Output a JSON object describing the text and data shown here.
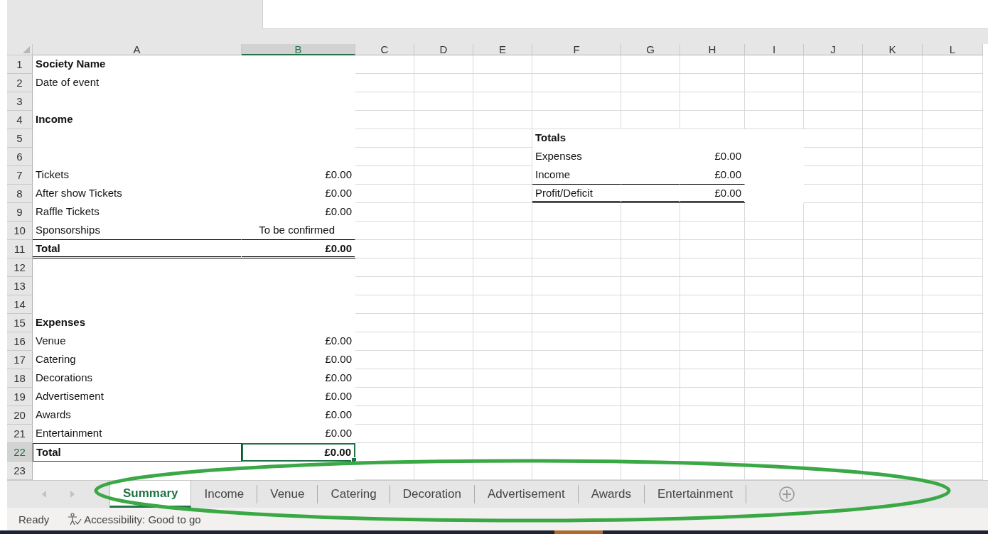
{
  "columns": [
    {
      "label": "A",
      "selected": false
    },
    {
      "label": "B",
      "selected": true
    },
    {
      "label": "C",
      "selected": false
    },
    {
      "label": "D",
      "selected": false
    },
    {
      "label": "E",
      "selected": false
    },
    {
      "label": "F",
      "selected": false
    },
    {
      "label": "G",
      "selected": false
    },
    {
      "label": "H",
      "selected": false
    },
    {
      "label": "I",
      "selected": false
    },
    {
      "label": "J",
      "selected": false
    },
    {
      "label": "K",
      "selected": false
    },
    {
      "label": "L",
      "selected": false
    }
  ],
  "rows": [
    {
      "number": "1",
      "selected": false,
      "a": {
        "text": "Society Name",
        "bold": true
      }
    },
    {
      "number": "2",
      "selected": false,
      "a": {
        "text": "Date of event"
      }
    },
    {
      "number": "3",
      "selected": false
    },
    {
      "number": "4",
      "selected": false,
      "a": {
        "text": "Income",
        "bold": true
      }
    },
    {
      "number": "5",
      "selected": false,
      "f": {
        "text": "Totals",
        "bold": true,
        "white_fill": true
      },
      "g": {
        "white_fill": true
      },
      "h": {
        "white_fill": true
      },
      "i": {
        "white_fill": true
      }
    },
    {
      "number": "6",
      "selected": false,
      "f": {
        "text": "Expenses",
        "white_fill": true
      },
      "g": {
        "white_fill": true
      },
      "h": {
        "text": "£0.00",
        "kind": "number",
        "white_fill": true
      },
      "i": {
        "white_fill": true
      }
    },
    {
      "number": "7",
      "selected": false,
      "a": {
        "text": "Tickets"
      },
      "b": {
        "text": "£0.00",
        "kind": "number"
      },
      "f": {
        "text": "Income",
        "white_fill": true,
        "rule_below": true
      },
      "g": {
        "white_fill": true,
        "rule_below": true
      },
      "h": {
        "text": "£0.00",
        "kind": "number",
        "white_fill": true,
        "rule_below": true
      },
      "i": {
        "white_fill": true
      }
    },
    {
      "number": "8",
      "selected": false,
      "a": {
        "text": "After show Tickets"
      },
      "b": {
        "text": "£0.00",
        "kind": "number"
      },
      "f": {
        "text": "Profit/Deficit",
        "white_fill": true,
        "double_rule_below": true
      },
      "g": {
        "white_fill": true,
        "double_rule_below": true
      },
      "h": {
        "text": "£0.00",
        "kind": "number",
        "white_fill": true,
        "double_rule_below": true
      },
      "i": {
        "white_fill": true
      }
    },
    {
      "number": "9",
      "selected": false,
      "a": {
        "text": "Raffle Tickets"
      },
      "b": {
        "text": "£0.00",
        "kind": "number"
      }
    },
    {
      "number": "10",
      "selected": false,
      "a": {
        "text": "Sponsorships",
        "rule_below": true
      },
      "b": {
        "text": "To be confirmed",
        "kind": "note",
        "rule_below": true
      }
    },
    {
      "number": "11",
      "selected": false,
      "a": {
        "text": "Total",
        "bold": true,
        "double_rule_below": true
      },
      "b": {
        "text": "£0.00",
        "bold": true,
        "kind": "number",
        "double_rule_below": true
      }
    },
    {
      "number": "12",
      "selected": false
    },
    {
      "number": "13",
      "selected": false
    },
    {
      "number": "14",
      "selected": false
    },
    {
      "number": "15",
      "selected": false,
      "a": {
        "text": "Expenses",
        "bold": true
      }
    },
    {
      "number": "16",
      "selected": false,
      "a": {
        "text": "Venue"
      },
      "b": {
        "text": "£0.00",
        "kind": "number"
      }
    },
    {
      "number": "17",
      "selected": false,
      "a": {
        "text": "Catering"
      },
      "b": {
        "text": "£0.00",
        "kind": "number"
      }
    },
    {
      "number": "18",
      "selected": false,
      "a": {
        "text": "Decorations"
      },
      "b": {
        "text": "£0.00",
        "kind": "number"
      }
    },
    {
      "number": "19",
      "selected": false,
      "a": {
        "text": "Advertisement"
      },
      "b": {
        "text": "£0.00",
        "kind": "number"
      }
    },
    {
      "number": "20",
      "selected": false,
      "a": {
        "text": "Awards"
      },
      "b": {
        "text": "£0.00",
        "kind": "number"
      }
    },
    {
      "number": "21",
      "selected": false,
      "a": {
        "text": "Entertainment"
      },
      "b": {
        "text": "£0.00",
        "kind": "number"
      }
    },
    {
      "number": "22",
      "selected": true,
      "a": {
        "text": "Total",
        "bold": true,
        "boxed": true
      },
      "b": {
        "text": "£0.00",
        "bold": true,
        "kind": "number",
        "selected": true
      }
    },
    {
      "number": "23",
      "selected": false
    }
  ],
  "sheet_tabs": [
    {
      "label": "Summary",
      "selected": true
    },
    {
      "label": "Income",
      "selected": false
    },
    {
      "label": "Venue",
      "selected": false
    },
    {
      "label": "Catering",
      "selected": false
    },
    {
      "label": "Decoration",
      "selected": false
    },
    {
      "label": "Advertisement",
      "selected": false
    },
    {
      "label": "Awards",
      "selected": false
    },
    {
      "label": "Entertainment",
      "selected": false
    }
  ],
  "status_bar": {
    "mode": "Ready",
    "accessibility": "Accessibility: Good to go"
  },
  "annotation": {
    "kind": "ellipse",
    "color": "#3aa845"
  }
}
